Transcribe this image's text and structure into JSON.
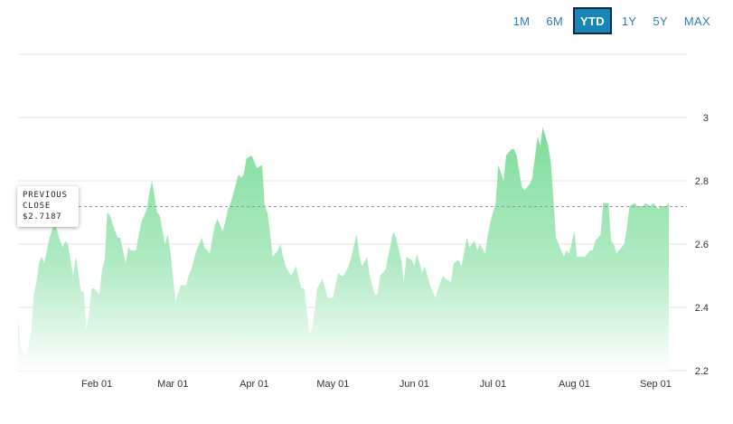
{
  "range_buttons": [
    {
      "label": "1M",
      "active": false
    },
    {
      "label": "6M",
      "active": false
    },
    {
      "label": "YTD",
      "active": true
    },
    {
      "label": "1Y",
      "active": false
    },
    {
      "label": "5Y",
      "active": false
    },
    {
      "label": "MAX",
      "active": false
    }
  ],
  "tooltip": {
    "line1": "PREVIOUS",
    "line2": "CLOSE",
    "value": "$2.7187"
  },
  "colors": {
    "area_top": "#7ddd98",
    "area_bottom": "#ffffff",
    "active_button": "#1a86b8",
    "button_text": "#2a7fb0",
    "gridline": "#e3e3e3",
    "reference_line": "#999999"
  },
  "chart_data": {
    "type": "area",
    "title": "",
    "xlabel": "",
    "ylabel": "",
    "ylim": [
      2.2,
      3.0
    ],
    "yticks": [
      2.2,
      2.4,
      2.6,
      2.8,
      3
    ],
    "ytick_labels": [
      "2.2",
      "2.4",
      "2.6",
      "2.8",
      "3"
    ],
    "xlim": [
      "2024-01-02",
      "2024-09-06"
    ],
    "xticks": [
      "2024-02-01",
      "2024-03-01",
      "2024-04-01",
      "2024-05-01",
      "2024-06-01",
      "2024-07-01",
      "2024-08-01",
      "2024-09-01"
    ],
    "xtick_labels": [
      "Feb 01",
      "Mar 01",
      "Apr 01",
      "May 01",
      "Jun 01",
      "Jul 01",
      "Aug 01",
      "Sep 01"
    ],
    "grid": true,
    "reference_line": {
      "label": "PREVIOUS CLOSE",
      "value": 2.7187
    },
    "series": [
      {
        "x": [
          "2024-01-02",
          "2024-01-03",
          "2024-01-04",
          "2024-01-05",
          "2024-01-06",
          "2024-01-07",
          "2024-01-08",
          "2024-01-09",
          "2024-01-10",
          "2024-01-11",
          "2024-01-12",
          "2024-01-14",
          "2024-01-16",
          "2024-01-18",
          "2024-01-19",
          "2024-01-20",
          "2024-01-21",
          "2024-01-23",
          "2024-01-24",
          "2024-01-26",
          "2024-01-27",
          "2024-01-28",
          "2024-01-29",
          "2024-01-30",
          "2024-01-31",
          "2024-02-02",
          "2024-02-03",
          "2024-02-04",
          "2024-02-05",
          "2024-02-06",
          "2024-02-08",
          "2024-02-09",
          "2024-02-10",
          "2024-02-12",
          "2024-02-13",
          "2024-02-14",
          "2024-02-16",
          "2024-02-17",
          "2024-02-18",
          "2024-02-19",
          "2024-02-20",
          "2024-02-21",
          "2024-02-22",
          "2024-02-24",
          "2024-02-25",
          "2024-02-27",
          "2024-02-28",
          "2024-02-29",
          "2024-03-02",
          "2024-03-04",
          "2024-03-06",
          "2024-03-07",
          "2024-03-08",
          "2024-03-10",
          "2024-03-12",
          "2024-03-13",
          "2024-03-14",
          "2024-03-15",
          "2024-03-17",
          "2024-03-18",
          "2024-03-19",
          "2024-03-20",
          "2024-03-22",
          "2024-03-23",
          "2024-03-24",
          "2024-03-26",
          "2024-03-27",
          "2024-03-28",
          "2024-03-29",
          "2024-03-31",
          "2024-04-02",
          "2024-04-04",
          "2024-04-05",
          "2024-04-06",
          "2024-04-07",
          "2024-04-08",
          "2024-04-10",
          "2024-04-11",
          "2024-04-12",
          "2024-04-13",
          "2024-04-15",
          "2024-04-17",
          "2024-04-18",
          "2024-04-19",
          "2024-04-20",
          "2024-04-22",
          "2024-04-23",
          "2024-04-24",
          "2024-04-25",
          "2024-04-27",
          "2024-04-28",
          "2024-04-29",
          "2024-05-01",
          "2024-05-03",
          "2024-05-04",
          "2024-05-05",
          "2024-05-07",
          "2024-05-08",
          "2024-05-10",
          "2024-05-11",
          "2024-05-12",
          "2024-05-14",
          "2024-05-15",
          "2024-05-17",
          "2024-05-18",
          "2024-05-19",
          "2024-05-21",
          "2024-05-22",
          "2024-05-24",
          "2024-05-25",
          "2024-05-27",
          "2024-05-28",
          "2024-05-29",
          "2024-05-31",
          "2024-06-01",
          "2024-06-02",
          "2024-06-04",
          "2024-06-05",
          "2024-06-07",
          "2024-06-08",
          "2024-06-09",
          "2024-06-11",
          "2024-06-12",
          "2024-06-13",
          "2024-06-15",
          "2024-06-16",
          "2024-06-18",
          "2024-06-19",
          "2024-06-21",
          "2024-06-22",
          "2024-06-24",
          "2024-06-25",
          "2024-06-26",
          "2024-06-28",
          "2024-06-29",
          "2024-06-30",
          "2024-07-02",
          "2024-07-03",
          "2024-07-05",
          "2024-07-06",
          "2024-07-08",
          "2024-07-09",
          "2024-07-10",
          "2024-07-12",
          "2024-07-13",
          "2024-07-15",
          "2024-07-16",
          "2024-07-18",
          "2024-07-19",
          "2024-07-20",
          "2024-07-22",
          "2024-07-23",
          "2024-07-25",
          "2024-07-26",
          "2024-07-28",
          "2024-07-29",
          "2024-07-30",
          "2024-08-01",
          "2024-08-02",
          "2024-08-04",
          "2024-08-05",
          "2024-08-07",
          "2024-08-08",
          "2024-08-09",
          "2024-08-11",
          "2024-08-12",
          "2024-08-14",
          "2024-08-15",
          "2024-08-16",
          "2024-08-17",
          "2024-08-18",
          "2024-08-20",
          "2024-08-21",
          "2024-08-22",
          "2024-08-24",
          "2024-08-25",
          "2024-08-27",
          "2024-08-28",
          "2024-08-30",
          "2024-08-31",
          "2024-09-02",
          "2024-09-03",
          "2024-09-05",
          "2024-09-06"
        ],
        "y": [
          2.37,
          2.27,
          2.26,
          2.25,
          2.28,
          2.32,
          2.44,
          2.48,
          2.54,
          2.56,
          2.54,
          2.62,
          2.67,
          2.61,
          2.59,
          2.61,
          2.6,
          2.5,
          2.56,
          2.45,
          2.45,
          2.33,
          2.38,
          2.46,
          2.46,
          2.44,
          2.52,
          2.55,
          2.7,
          2.69,
          2.64,
          2.62,
          2.62,
          2.54,
          2.59,
          2.58,
          2.58,
          2.63,
          2.67,
          2.69,
          2.71,
          2.76,
          2.8,
          2.7,
          2.69,
          2.6,
          2.63,
          2.58,
          2.42,
          2.47,
          2.47,
          2.5,
          2.52,
          2.58,
          2.62,
          2.59,
          2.58,
          2.57,
          2.66,
          2.68,
          2.66,
          2.64,
          2.71,
          2.73,
          2.76,
          2.82,
          2.81,
          2.82,
          2.87,
          2.88,
          2.84,
          2.85,
          2.72,
          2.7,
          2.64,
          2.56,
          2.58,
          2.6,
          2.56,
          2.53,
          2.5,
          2.53,
          2.49,
          2.46,
          2.46,
          2.32,
          2.33,
          2.39,
          2.46,
          2.49,
          2.46,
          2.43,
          2.43,
          2.51,
          2.5,
          2.5,
          2.53,
          2.56,
          2.63,
          2.57,
          2.53,
          2.56,
          2.5,
          2.44,
          2.44,
          2.5,
          2.52,
          2.56,
          2.64,
          2.62,
          2.55,
          2.48,
          2.56,
          2.55,
          2.53,
          2.57,
          2.51,
          2.53,
          2.47,
          2.45,
          2.43,
          2.48,
          2.5,
          2.49,
          2.48,
          2.54,
          2.55,
          2.53,
          2.62,
          2.59,
          2.61,
          2.58,
          2.6,
          2.57,
          2.63,
          2.67,
          2.73,
          2.85,
          2.8,
          2.88,
          2.9,
          2.9,
          2.88,
          2.78,
          2.77,
          2.79,
          2.81,
          2.94,
          2.91,
          2.97,
          2.91,
          2.86,
          2.62,
          2.6,
          2.56,
          2.58,
          2.57,
          2.64,
          2.56,
          2.56,
          2.56,
          2.58,
          2.58,
          2.61,
          2.63,
          2.73,
          2.73,
          2.61,
          2.6,
          2.57,
          2.58,
          2.6,
          2.65,
          2.72,
          2.73,
          2.72,
          2.72,
          2.73,
          2.72,
          2.73,
          2.71,
          2.72,
          2.72,
          2.73
        ]
      }
    ]
  }
}
